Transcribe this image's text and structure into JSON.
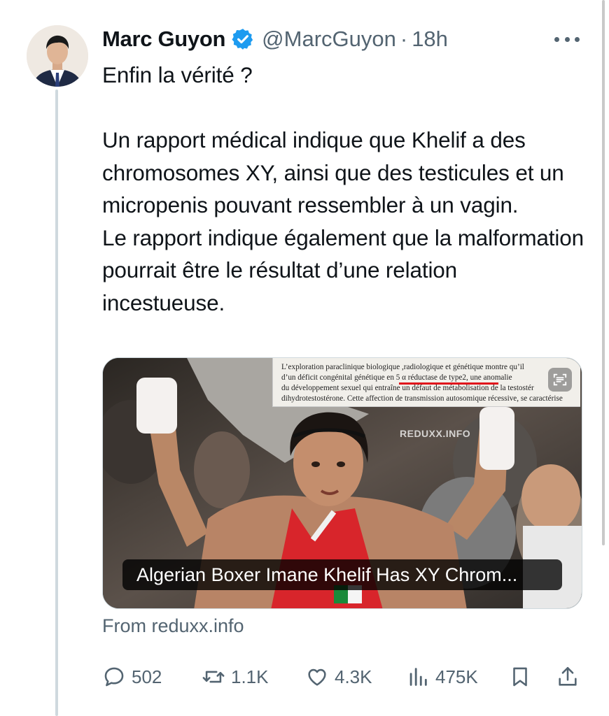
{
  "author": {
    "name": "Marc Guyon",
    "handle": "@MarcGuyon",
    "separator": "·",
    "time": "18h"
  },
  "tweet": {
    "text": "Enfin la vérité ?\n\nUn rapport médical indique que Khelif a des chromosomes XY, ainsi que des testicules et un micropenis pouvant ressembler à un vagin.\nLe rapport indique également que la malformation pourrait être le résultat d’une relation incestueuse."
  },
  "media": {
    "doc_lines": [
      "L’exploration paraclinique biologique ,radiologique et génétique montre qu’il",
      "d’un déficit congénital génétique en 5 α réductase de type2, une anomalie",
      "du développement sexuel qui entraîne un défaut de métabolisation de la testostér",
      "dihydrotestostérone. Cette affection de transmission autosomique récessive, se caractérise"
    ],
    "watermark": "REDUXX.INFO",
    "caption": "Algerian Boxer Imane Khelif Has XY Chrom..."
  },
  "source": "From reduxx.info",
  "actions": {
    "replies": "502",
    "reposts": "1.1K",
    "likes": "4.3K",
    "views": "475K"
  },
  "icons": {
    "verified": "verified-badge-icon",
    "more": "more-dots-icon",
    "reply": "reply-bubble-icon",
    "repost": "repost-icon",
    "like": "heart-icon",
    "views": "views-bar-chart-icon",
    "bookmark": "bookmark-icon",
    "share": "share-icon",
    "scan": "text-scan-icon"
  },
  "colors": {
    "verified_blue": "#1d9bf0",
    "secondary_text": "#536471",
    "highlight_red": "#e0151c"
  }
}
